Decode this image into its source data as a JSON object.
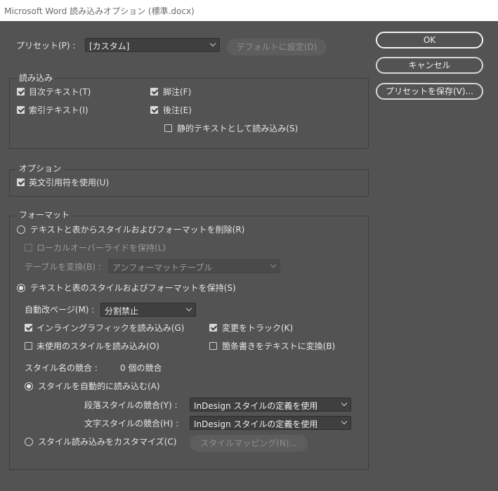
{
  "window": {
    "title": "Microsoft Word 読み込みオプション (標準.docx)"
  },
  "preset": {
    "label": "プリセット(P) :",
    "value": "[カスタム]",
    "default_button": "デフォルトに設定(D)"
  },
  "buttons": {
    "ok": "OK",
    "cancel": "キャンセル",
    "save_preset": "プリセットを保存(V)..."
  },
  "import": {
    "title": "読み込み",
    "toc_text": {
      "label": "目次テキスト(T)",
      "checked": true
    },
    "footnotes": {
      "label": "脚注(F)",
      "checked": true
    },
    "index_text": {
      "label": "索引テキスト(I)",
      "checked": true
    },
    "endnotes": {
      "label": "後注(E)",
      "checked": true
    },
    "static_text": {
      "label": "静的テキストとして読み込み(S)",
      "checked": false
    }
  },
  "options": {
    "title": "オプション",
    "typographer_quotes": {
      "label": "英文引用符を使用(U)",
      "checked": true
    }
  },
  "format": {
    "title": "フォーマット",
    "remove_styles": {
      "label": "テキストと表からスタイルおよびフォーマットを削除(R)",
      "selected": false
    },
    "preserve_local": {
      "label": "ローカルオーバーライドを保持(L)",
      "checked": false,
      "disabled": true
    },
    "table_convert": {
      "label": "テーブルを変換(B) :",
      "value": "アンフォーマットテーブル",
      "disabled": true
    },
    "preserve_styles": {
      "label": "テキストと表のスタイルおよびフォーマットを保持(S)",
      "selected": true
    },
    "page_break": {
      "label": "自動改ページ(M) :",
      "value": "分割禁止"
    },
    "inline_graphics": {
      "label": "インライングラフィックを読み込み(G)",
      "checked": true
    },
    "track_changes": {
      "label": "変更をトラック(K)",
      "checked": true
    },
    "unused_styles": {
      "label": "未使用のスタイルを読み込み(O)",
      "checked": false
    },
    "bullets_to_text": {
      "label": "箇条書きをテキストに変換(B)",
      "checked": false
    },
    "style_conflicts": {
      "label": "スタイル名の競合 :",
      "value": "0 個の競合"
    },
    "auto_import": {
      "label": "スタイルを自動的に読み込む(A)",
      "selected": true
    },
    "para_conflict": {
      "label": "段落スタイルの競合(Y) :",
      "value": "InDesign スタイルの定義を使用"
    },
    "char_conflict": {
      "label": "文字スタイルの競合(H) :",
      "value": "InDesign スタイルの定義を使用"
    },
    "customize": {
      "label": "スタイル読み込みをカスタマイズ(C)",
      "selected": false
    },
    "style_mapping_button": "スタイルマッピング(N)..."
  }
}
